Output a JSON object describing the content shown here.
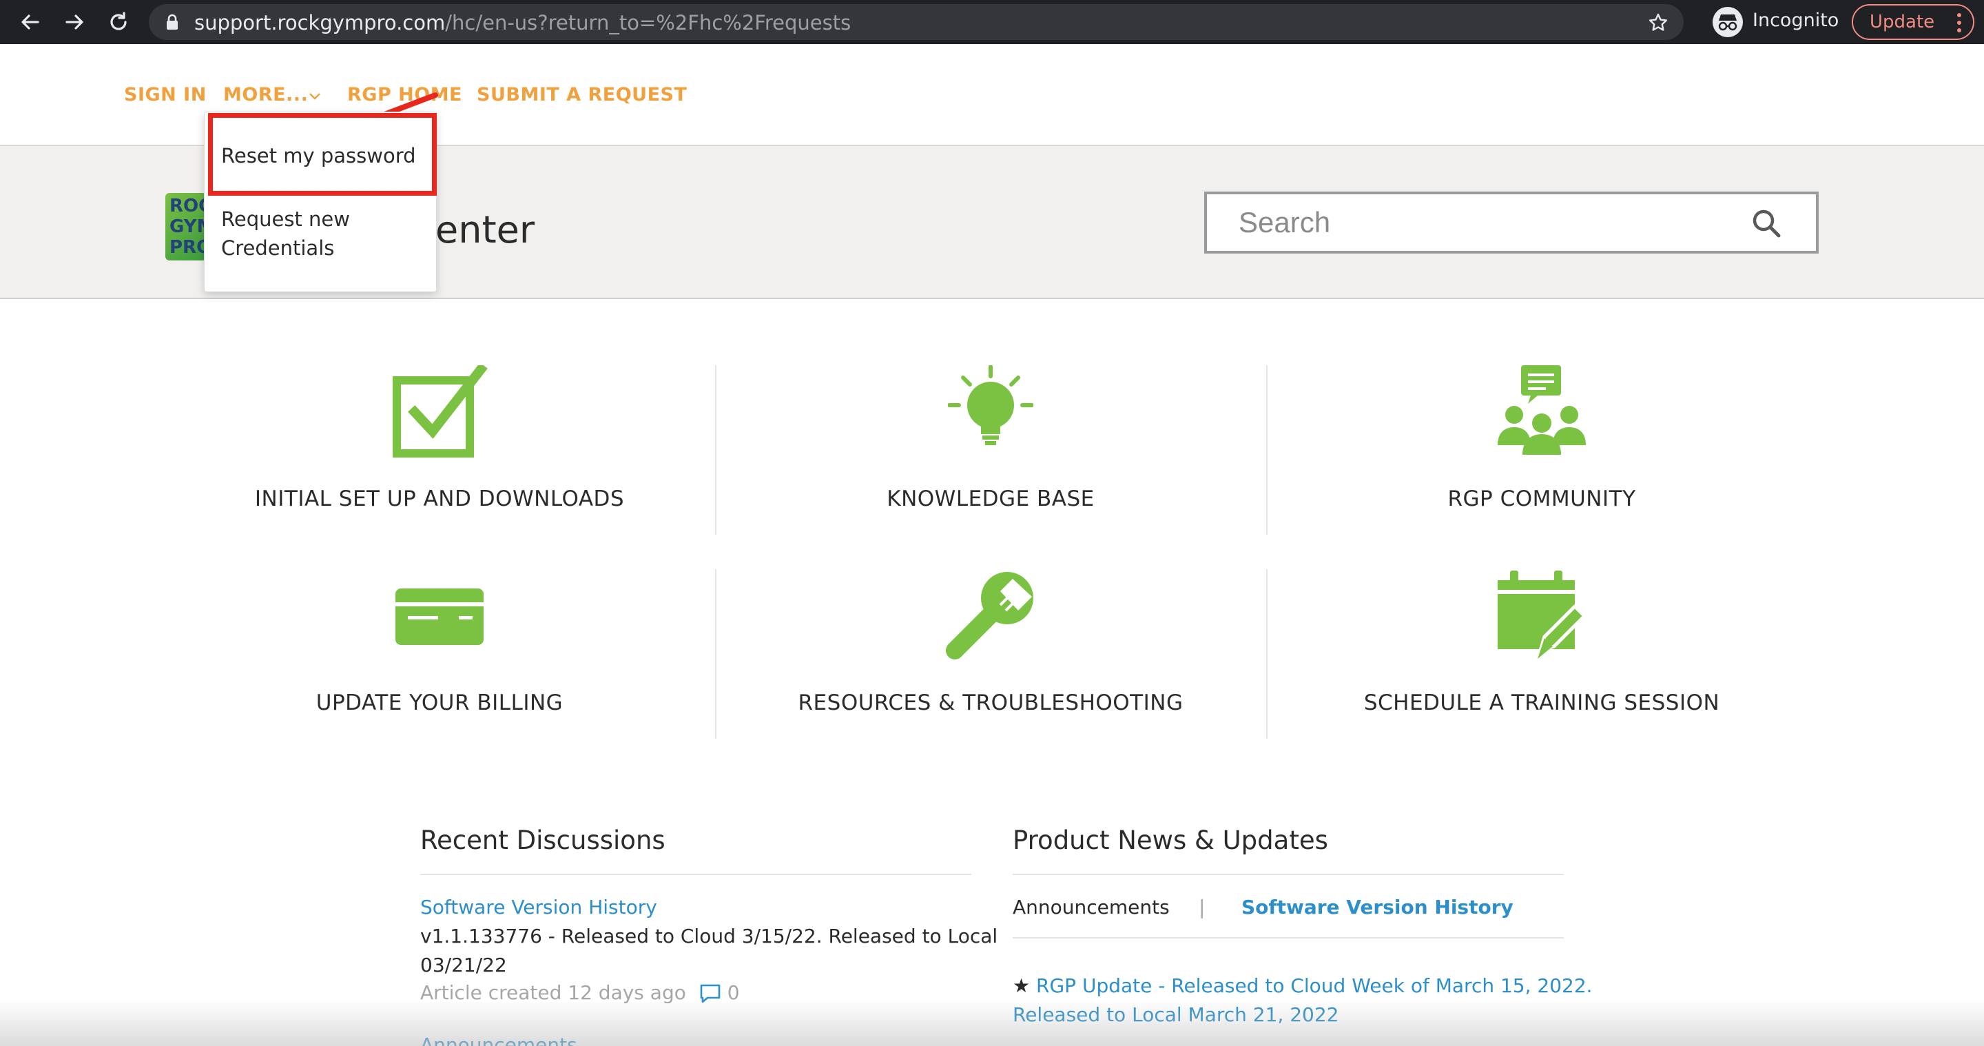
{
  "browser": {
    "url_host": "support.rockgympro.com",
    "url_path": "/hc/en-us?return_to=%2Fhc%2Frequests",
    "incognito_label": "Incognito",
    "update_label": "Update"
  },
  "topnav": {
    "sign_in": "SIGN IN",
    "more": "MORE...",
    "rgp_home": "RGP HOME",
    "submit_request": "SUBMIT A REQUEST"
  },
  "dropdown": {
    "reset_password": "Reset my password",
    "request_line1": "Request new",
    "request_line2": "Credentials"
  },
  "hero": {
    "logo_l1": "ROC",
    "logo_l2": "GYM",
    "logo_l3": "PRO",
    "title": "enter",
    "search_placeholder": "Search"
  },
  "categories": [
    {
      "label": "INITIAL SET UP AND DOWNLOADS",
      "icon": "checkbox-icon"
    },
    {
      "label": "KNOWLEDGE BASE",
      "icon": "lightbulb-icon"
    },
    {
      "label": "RGP COMMUNITY",
      "icon": "community-icon"
    },
    {
      "label": "UPDATE YOUR BILLING",
      "icon": "credit-card-icon"
    },
    {
      "label": "RESOURCES & TROUBLESHOOTING",
      "icon": "wrench-icon"
    },
    {
      "label": "SCHEDULE A TRAINING SESSION",
      "icon": "calendar-edit-icon"
    }
  ],
  "recent": {
    "title": "Recent Discussions",
    "item_title": "Software Version History",
    "item_line1": "v1.1.133776 - Released to Cloud 3/15/22. Released to Local",
    "item_line2": "03/21/22",
    "item_meta": "Article created 12 days ago",
    "comment_count": "0",
    "next_link": "Announcements"
  },
  "news": {
    "title": "Product News & Updates",
    "tab_announcements": "Announcements",
    "separator": "|",
    "tab_software": "Software Version History",
    "item_line1": "RGP Update - Released to Cloud Week of March 15, 2022.",
    "item_line2": "Released to Local March 21, 2022"
  },
  "colors": {
    "accent_orange": "#f0a13e",
    "icon_green": "#7cc242",
    "link_blue": "#2c8fc9",
    "annotation_red": "#e8281e"
  }
}
